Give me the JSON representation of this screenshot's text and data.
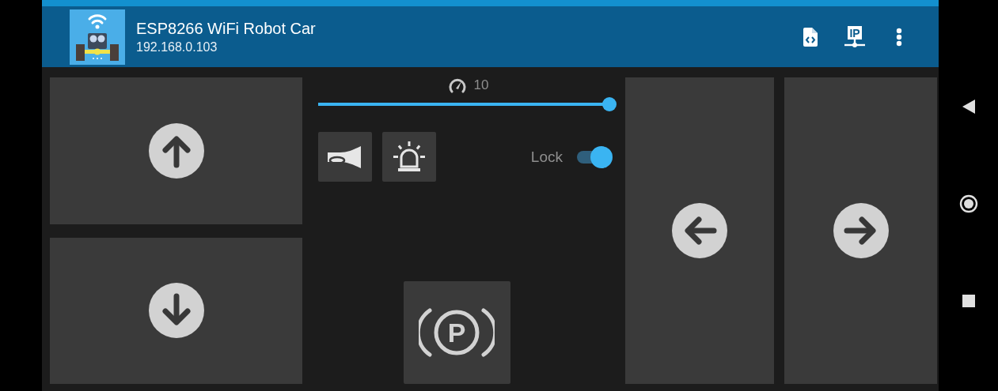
{
  "app_bar": {
    "title": "ESP8266 WiFi Robot Car",
    "subtitle": "192.168.0.103",
    "actions": [
      {
        "kind": "code-file"
      },
      {
        "kind": "ip-network",
        "text": "IP"
      },
      {
        "kind": "more"
      }
    ]
  },
  "drive_pad": [
    {
      "kind": "up"
    },
    {
      "kind": "down"
    }
  ],
  "speed": {
    "reading": "10",
    "level": 1
  },
  "actions": [
    {
      "kind": "horn"
    },
    {
      "kind": "beacon"
    }
  ],
  "lock": {
    "label": "Lock",
    "on": true
  },
  "parking": {
    "letter": "P"
  },
  "steering": [
    {
      "kind": "left"
    },
    {
      "kind": "right"
    }
  ],
  "system_nav": [
    {
      "kind": "back"
    },
    {
      "kind": "home"
    },
    {
      "kind": "recents"
    }
  ]
}
